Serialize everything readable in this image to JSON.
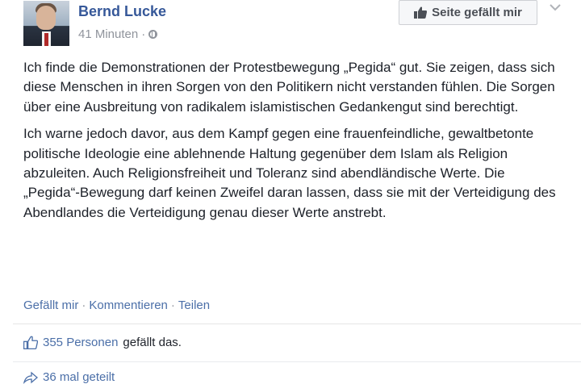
{
  "post": {
    "author": "Bernd Lucke",
    "timestamp": "41 Minuten",
    "separator": "·",
    "like_page_label": "Seite gefällt mir",
    "paragraphs": [
      "Ich finde die Demonstrationen der Protestbewegung „Pegida“ gut. Sie zeigen, dass sich diese Menschen in ihren Sorgen von den Politikern nicht verstanden fühlen. Die Sorgen über eine Ausbreitung von radikalem islamistischen Gedankengut sind berechtigt.",
      "Ich warne jedoch davor, aus dem Kampf gegen eine frauenfeindliche, gewaltbetonte politische Ideologie eine ablehnende Haltung gegenüber dem Islam als Religion abzuleiten. Auch Religionsfreiheit und Toleranz sind abendländische Werte. Die „Pegida“-Bewegung darf keinen Zweifel daran lassen, dass sie mit der Verteidigung des Abendlandes die Verteidigung genau dieser Werte anstrebt."
    ],
    "actions": {
      "like": "Gefällt mir",
      "comment": "Kommentieren",
      "share": "Teilen",
      "sep": "·"
    },
    "likes": {
      "count_text": "355 Personen",
      "suffix": "gefällt das."
    },
    "shares": {
      "text": "36 mal geteilt"
    }
  },
  "colors": {
    "link": "#365899",
    "muted": "#90949c",
    "text": "#1d2129"
  },
  "icons": [
    "globe-icon",
    "thumbs-up-icon",
    "chevron-down-icon",
    "share-icon"
  ]
}
